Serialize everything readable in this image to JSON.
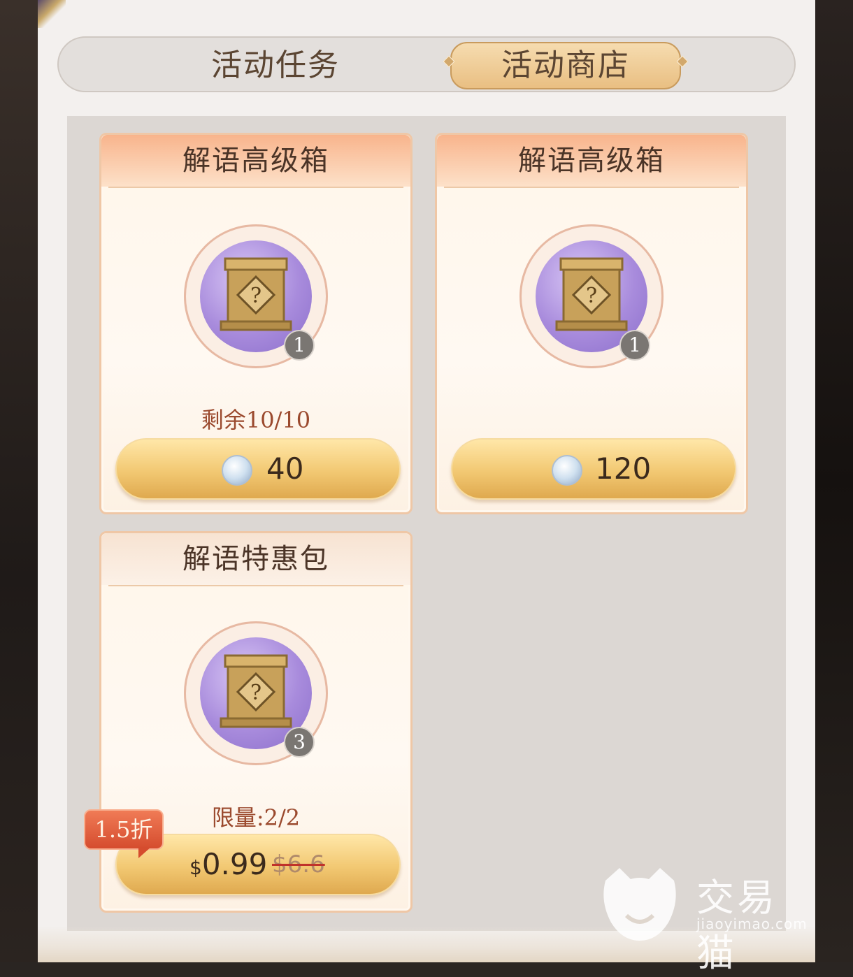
{
  "tabs": {
    "tasks": "活动任务",
    "shop": "活动商店",
    "active": "shop"
  },
  "shop_items": [
    {
      "name": "解语高级箱",
      "icon": "mystery-chest-icon",
      "quantity": "1",
      "remaining": "剩余10/10",
      "currency_icon": "silver-coin-icon",
      "price": "40"
    },
    {
      "name": "解语高级箱",
      "icon": "mystery-chest-icon",
      "quantity": "1",
      "remaining": "",
      "currency_icon": "silver-coin-icon",
      "price": "120"
    },
    {
      "name": "解语特惠包",
      "icon": "mystery-chest-icon",
      "quantity": "3",
      "remaining": "限量:2/2",
      "discount": "1.5折",
      "price_currency": "$",
      "price": "0.99",
      "original_price": "$6.6"
    }
  ],
  "watermark": {
    "text": "交易猫",
    "domain": "jiaoyimao.com"
  },
  "colors": {
    "header_orange": "#f8b48c",
    "price_gold": "#f2c872",
    "discount_red": "#d54c2e",
    "ring_purple": "#a88bdc"
  }
}
